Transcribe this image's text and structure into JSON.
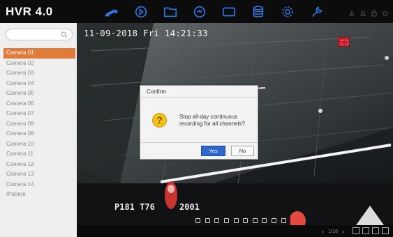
{
  "app": {
    "title": "HVR 4.0"
  },
  "nav": {
    "icons": [
      "live-view-icon",
      "playback-icon",
      "file-management-icon",
      "smart-analysis-icon",
      "hdd-icon",
      "storage-icon",
      "configuration-icon",
      "maintenance-icon"
    ],
    "active": "live-view-icon"
  },
  "sidebar": {
    "search_placeholder": "",
    "cameras": [
      "Camera 01",
      "Camera 02",
      "Camera 03",
      "Camera 04",
      "Camera 05",
      "Camera 06",
      "Camera 07",
      "Camera 08",
      "Camera 09",
      "Camera 10",
      "Camera 11",
      "Camera 12",
      "Camera 13",
      "Camera 14",
      "IPdome"
    ],
    "selected": "Camera 01"
  },
  "video": {
    "osd_datetime": "11-09-2018 Fri 14:21:33",
    "osd_camera_name": "P181 T76",
    "osd_year": "2001"
  },
  "bottom": {
    "page": "1/16"
  },
  "dialog": {
    "title": "Confirm",
    "icon": "question-icon",
    "icon_glyph": "?",
    "message": "Stop all-day continuous recording for all channels?",
    "yes_label": "Yes",
    "no_label": "No"
  },
  "colors": {
    "accent": "#e07b3a",
    "nav_active": "#2f7ae6",
    "primary_button": "#2f66c9",
    "warning": "#f2c21a",
    "record": "#c9202a"
  }
}
